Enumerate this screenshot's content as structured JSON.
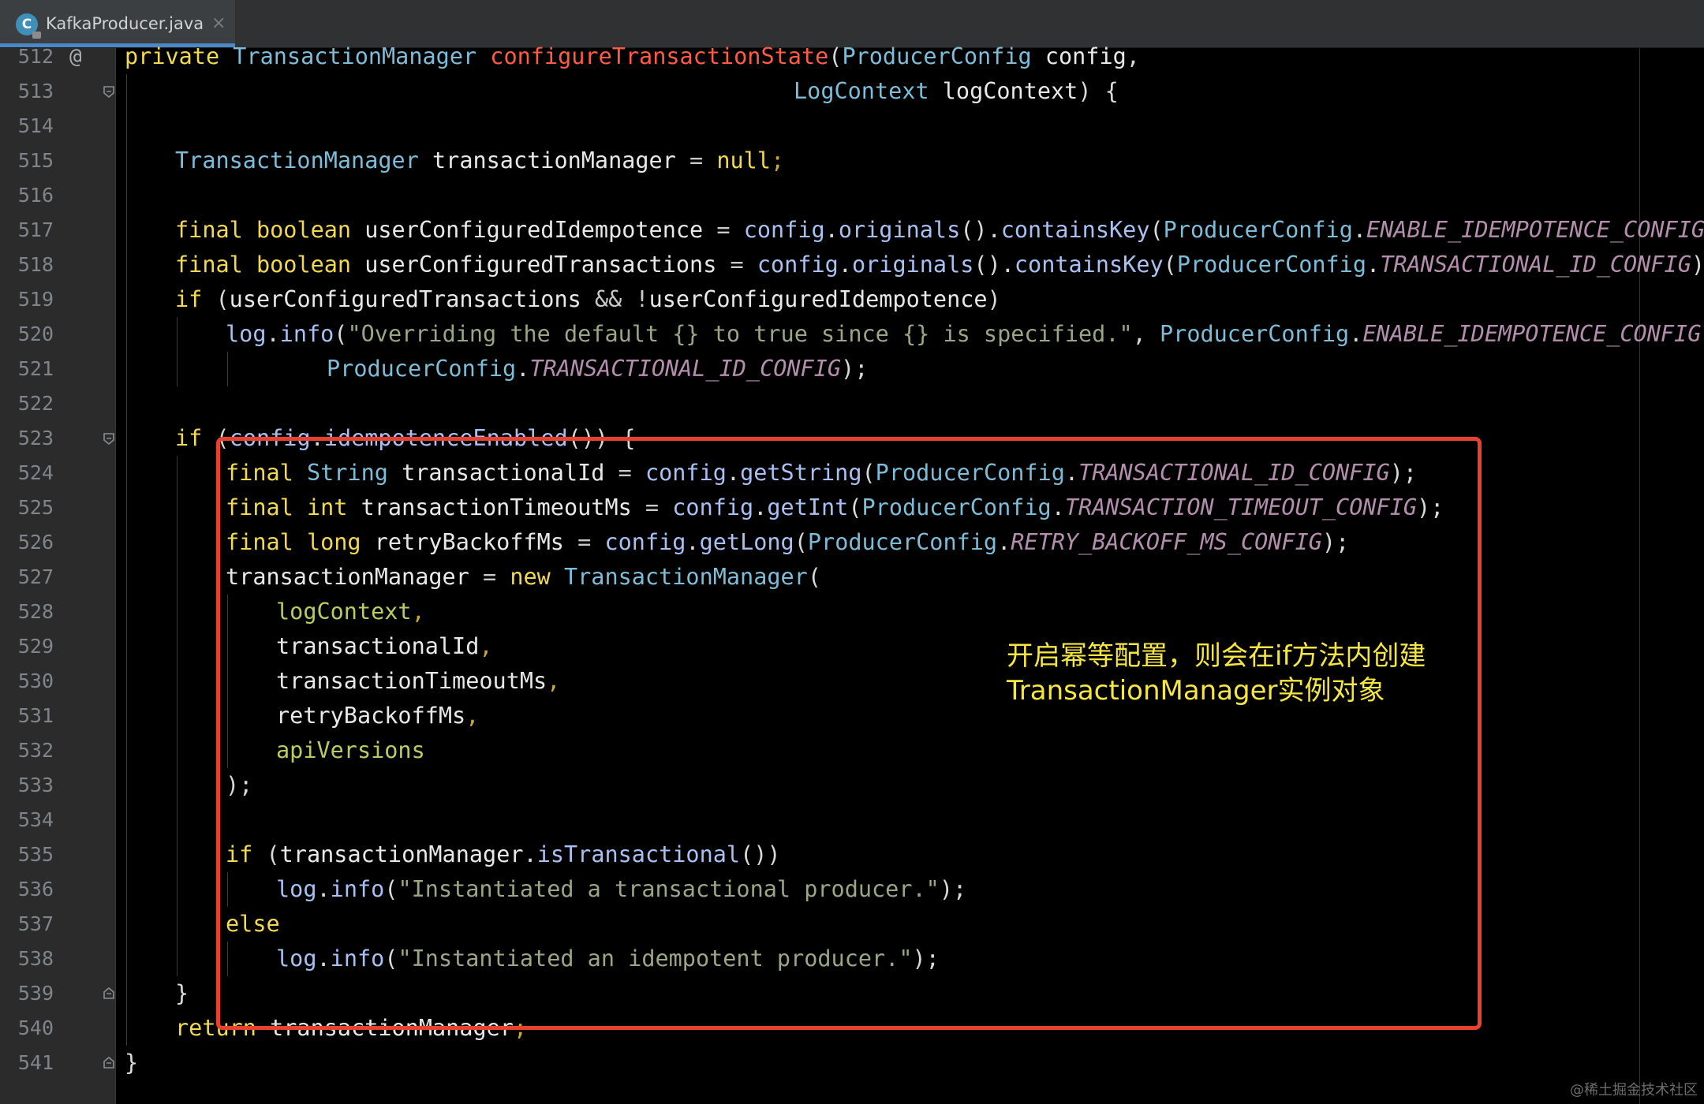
{
  "tab": {
    "file_name": "KafkaProducer.java",
    "close_glyph": "×",
    "icon": "java-class-icon",
    "icon_letter": "C"
  },
  "gutter": {
    "line_numbers": [
      "512",
      "513",
      "514",
      "515",
      "516",
      "517",
      "518",
      "519",
      "520",
      "521",
      "522",
      "523",
      "524",
      "525",
      "526",
      "527",
      "528",
      "529",
      "530",
      "531",
      "532",
      "533",
      "534",
      "535",
      "536",
      "537",
      "538",
      "539",
      "540",
      "541"
    ],
    "override_marker": "@"
  },
  "code": {
    "l512": [
      {
        "t": "private ",
        "c": "kw"
      },
      {
        "t": "TransactionManager ",
        "c": "ty"
      },
      {
        "t": "configureTransactionState",
        "c": "fn"
      },
      {
        "t": "(",
        "c": "pun"
      },
      {
        "t": "ProducerConfig ",
        "c": "ty"
      },
      {
        "t": "config",
        "c": "id"
      },
      {
        "t": ",",
        "c": "pun"
      }
    ],
    "l513": [
      {
        "t": "LogContext ",
        "c": "ty"
      },
      {
        "t": "logContext",
        "c": "id"
      },
      {
        "t": ") {",
        "c": "pun"
      }
    ],
    "l515": [
      {
        "t": "TransactionManager ",
        "c": "ty"
      },
      {
        "t": "transactionManager ",
        "c": "id"
      },
      {
        "t": "= ",
        "c": "op"
      },
      {
        "t": "null",
        "c": "kw"
      },
      {
        "t": ";",
        "c": "semi"
      }
    ],
    "l517": [
      {
        "t": "final ",
        "c": "kw"
      },
      {
        "t": "boolean ",
        "c": "kw"
      },
      {
        "t": "userConfiguredIdempotence ",
        "c": "id"
      },
      {
        "t": "= ",
        "c": "op"
      },
      {
        "t": "config",
        "c": "me"
      },
      {
        "t": ".",
        "c": "pun"
      },
      {
        "t": "originals",
        "c": "me"
      },
      {
        "t": "().",
        "c": "pun"
      },
      {
        "t": "containsKey",
        "c": "me"
      },
      {
        "t": "(",
        "c": "pun"
      },
      {
        "t": "ProducerConfig",
        "c": "ty"
      },
      {
        "t": ".",
        "c": "pun"
      },
      {
        "t": "ENABLE_IDEMPOTENCE_CONFIG",
        "c": "cst"
      },
      {
        "t": ");",
        "c": "pun"
      }
    ],
    "l518": [
      {
        "t": "final ",
        "c": "kw"
      },
      {
        "t": "boolean ",
        "c": "kw"
      },
      {
        "t": "userConfiguredTransactions ",
        "c": "id"
      },
      {
        "t": "= ",
        "c": "op"
      },
      {
        "t": "config",
        "c": "me"
      },
      {
        "t": ".",
        "c": "pun"
      },
      {
        "t": "originals",
        "c": "me"
      },
      {
        "t": "().",
        "c": "pun"
      },
      {
        "t": "containsKey",
        "c": "me"
      },
      {
        "t": "(",
        "c": "pun"
      },
      {
        "t": "ProducerConfig",
        "c": "ty"
      },
      {
        "t": ".",
        "c": "pun"
      },
      {
        "t": "TRANSACTIONAL_ID_CONFIG",
        "c": "cst"
      },
      {
        "t": ");",
        "c": "pun"
      }
    ],
    "l519": [
      {
        "t": "if ",
        "c": "kw"
      },
      {
        "t": "(",
        "c": "pun"
      },
      {
        "t": "userConfiguredTransactions ",
        "c": "id"
      },
      {
        "t": "&& !",
        "c": "op"
      },
      {
        "t": "userConfiguredIdempotence",
        "c": "id"
      },
      {
        "t": ")",
        "c": "pun"
      }
    ],
    "l520": [
      {
        "t": "log",
        "c": "me"
      },
      {
        "t": ".",
        "c": "pun"
      },
      {
        "t": "info",
        "c": "me"
      },
      {
        "t": "(",
        "c": "pun"
      },
      {
        "t": "\"Overriding the default {} to true since {} is specified.\"",
        "c": "str"
      },
      {
        "t": ", ",
        "c": "pun"
      },
      {
        "t": "ProducerConfig",
        "c": "ty"
      },
      {
        "t": ".",
        "c": "pun"
      },
      {
        "t": "ENABLE_IDEMPOTENCE_CONFIG",
        "c": "cst"
      },
      {
        "t": ",",
        "c": "pun"
      }
    ],
    "l521": [
      {
        "t": "ProducerConfig",
        "c": "ty"
      },
      {
        "t": ".",
        "c": "pun"
      },
      {
        "t": "TRANSACTIONAL_ID_CONFIG",
        "c": "cst"
      },
      {
        "t": ");",
        "c": "pun"
      }
    ],
    "l523": [
      {
        "t": "if ",
        "c": "kw"
      },
      {
        "t": "(",
        "c": "pun"
      },
      {
        "t": "config",
        "c": "me"
      },
      {
        "t": ".",
        "c": "pun"
      },
      {
        "t": "idempotenceEnabled",
        "c": "me"
      },
      {
        "t": "()) {",
        "c": "pun"
      }
    ],
    "l524": [
      {
        "t": "final ",
        "c": "kw"
      },
      {
        "t": "String ",
        "c": "ty"
      },
      {
        "t": "transactionalId ",
        "c": "id"
      },
      {
        "t": "= ",
        "c": "op"
      },
      {
        "t": "config",
        "c": "me"
      },
      {
        "t": ".",
        "c": "pun"
      },
      {
        "t": "getString",
        "c": "me"
      },
      {
        "t": "(",
        "c": "pun"
      },
      {
        "t": "ProducerConfig",
        "c": "ty"
      },
      {
        "t": ".",
        "c": "pun"
      },
      {
        "t": "TRANSACTIONAL_ID_CONFIG",
        "c": "cst"
      },
      {
        "t": ");",
        "c": "pun"
      }
    ],
    "l525": [
      {
        "t": "final ",
        "c": "kw"
      },
      {
        "t": "int ",
        "c": "kw"
      },
      {
        "t": "transactionTimeoutMs ",
        "c": "id"
      },
      {
        "t": "= ",
        "c": "op"
      },
      {
        "t": "config",
        "c": "me"
      },
      {
        "t": ".",
        "c": "pun"
      },
      {
        "t": "getInt",
        "c": "me"
      },
      {
        "t": "(",
        "c": "pun"
      },
      {
        "t": "ProducerConfig",
        "c": "ty"
      },
      {
        "t": ".",
        "c": "pun"
      },
      {
        "t": "TRANSACTION_TIMEOUT_CONFIG",
        "c": "cst"
      },
      {
        "t": ");",
        "c": "pun"
      }
    ],
    "l526": [
      {
        "t": "final ",
        "c": "kw"
      },
      {
        "t": "long ",
        "c": "kw"
      },
      {
        "t": "retryBackoffMs ",
        "c": "id"
      },
      {
        "t": "= ",
        "c": "op"
      },
      {
        "t": "config",
        "c": "me"
      },
      {
        "t": ".",
        "c": "pun"
      },
      {
        "t": "getLong",
        "c": "me"
      },
      {
        "t": "(",
        "c": "pun"
      },
      {
        "t": "ProducerConfig",
        "c": "ty"
      },
      {
        "t": ".",
        "c": "pun"
      },
      {
        "t": "RETRY_BACKOFF_MS_CONFIG",
        "c": "cst"
      },
      {
        "t": ");",
        "c": "pun"
      }
    ],
    "l527": [
      {
        "t": "transactionManager ",
        "c": "id"
      },
      {
        "t": "= ",
        "c": "op"
      },
      {
        "t": "new ",
        "c": "kw"
      },
      {
        "t": "TransactionManager",
        "c": "ty"
      },
      {
        "t": "(",
        "c": "pun"
      }
    ],
    "l528": [
      {
        "t": "logContext",
        "c": "var"
      },
      {
        "t": ",",
        "c": "semi"
      }
    ],
    "l529": [
      {
        "t": "transactionalId",
        "c": "id"
      },
      {
        "t": ",",
        "c": "semi"
      }
    ],
    "l530": [
      {
        "t": "transactionTimeoutMs",
        "c": "id"
      },
      {
        "t": ",",
        "c": "semi"
      }
    ],
    "l531": [
      {
        "t": "retryBackoffMs",
        "c": "id"
      },
      {
        "t": ",",
        "c": "semi"
      }
    ],
    "l532": [
      {
        "t": "apiVersions",
        "c": "var"
      }
    ],
    "l533": [
      {
        "t": ");",
        "c": "pun"
      }
    ],
    "l535": [
      {
        "t": "if ",
        "c": "kw"
      },
      {
        "t": "(",
        "c": "pun"
      },
      {
        "t": "transactionManager",
        "c": "id"
      },
      {
        "t": ".",
        "c": "pun"
      },
      {
        "t": "isTransactional",
        "c": "me"
      },
      {
        "t": "())",
        "c": "pun"
      }
    ],
    "l536": [
      {
        "t": "log",
        "c": "me"
      },
      {
        "t": ".",
        "c": "pun"
      },
      {
        "t": "info",
        "c": "me"
      },
      {
        "t": "(",
        "c": "pun"
      },
      {
        "t": "\"Instantiated a transactional producer.\"",
        "c": "str"
      },
      {
        "t": ");",
        "c": "pun"
      }
    ],
    "l537": [
      {
        "t": "else",
        "c": "kw"
      }
    ],
    "l538": [
      {
        "t": "log",
        "c": "me"
      },
      {
        "t": ".",
        "c": "pun"
      },
      {
        "t": "info",
        "c": "me"
      },
      {
        "t": "(",
        "c": "pun"
      },
      {
        "t": "\"Instantiated an idempotent producer.\"",
        "c": "str"
      },
      {
        "t": ");",
        "c": "pun"
      }
    ],
    "l539": [
      {
        "t": "}",
        "c": "pun"
      }
    ],
    "l540": [
      {
        "t": "return ",
        "c": "kw"
      },
      {
        "t": "transactionManager",
        "c": "id"
      },
      {
        "t": ";",
        "c": "semi"
      }
    ],
    "l541": [
      {
        "t": "}",
        "c": "pun"
      }
    ]
  },
  "annotation": {
    "line1": "开启幂等配置，则会在if方法内创建",
    "line2": "TransactionManager实例对象"
  },
  "watermark": "@稀土掘金技术社区",
  "colors": {
    "highlight_box": "#e8412f",
    "annotation_text": "#f5e640",
    "tab_underline": "#4a88c7"
  }
}
